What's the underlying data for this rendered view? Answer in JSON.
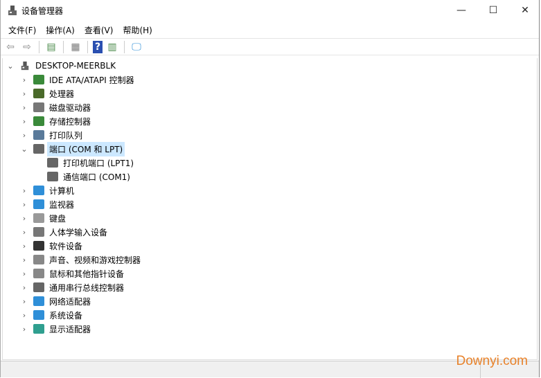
{
  "window": {
    "title": "设备管理器",
    "minimize": "—",
    "maximize": "☐",
    "close": "✕"
  },
  "menu": [
    "文件(F)",
    "操作(A)",
    "查看(V)",
    "帮助(H)"
  ],
  "toolbar": {
    "back": "⇦",
    "forward": "⇨",
    "properties": "▤",
    "update": "▦",
    "help": "?",
    "view": "▥",
    "scan": "🖵"
  },
  "tree": {
    "root": "DESKTOP-MEERBLK",
    "items": [
      {
        "label": "IDE ATA/ATAPI 控制器",
        "icon": "ide-icon",
        "color": "#3a8a3a"
      },
      {
        "label": "处理器",
        "icon": "cpu-icon",
        "color": "#4a6a2a"
      },
      {
        "label": "磁盘驱动器",
        "icon": "disk-icon",
        "color": "#777777"
      },
      {
        "label": "存储控制器",
        "icon": "storage-icon",
        "color": "#3a8a3a"
      },
      {
        "label": "打印队列",
        "icon": "printer-icon",
        "color": "#5a7a9a"
      },
      {
        "label": "端口 (COM 和 LPT)",
        "icon": "port-icon",
        "color": "#666666",
        "expanded": true,
        "children": [
          {
            "label": "打印机端口 (LPT1)",
            "icon": "port-icon"
          },
          {
            "label": "通信端口 (COM1)",
            "icon": "port-icon"
          }
        ]
      },
      {
        "label": "计算机",
        "icon": "computer-icon",
        "color": "#2f8fd8"
      },
      {
        "label": "监视器",
        "icon": "monitor-icon",
        "color": "#2f8fd8"
      },
      {
        "label": "键盘",
        "icon": "keyboard-icon",
        "color": "#999999"
      },
      {
        "label": "人体学输入设备",
        "icon": "hid-icon",
        "color": "#777777"
      },
      {
        "label": "软件设备",
        "icon": "software-device-icon",
        "color": "#333333"
      },
      {
        "label": "声音、视频和游戏控制器",
        "icon": "speaker-icon",
        "color": "#888888"
      },
      {
        "label": "鼠标和其他指针设备",
        "icon": "mouse-icon",
        "color": "#888888"
      },
      {
        "label": "通用串行总线控制器",
        "icon": "usb-icon",
        "color": "#666666"
      },
      {
        "label": "网络适配器",
        "icon": "network-icon",
        "color": "#2f8fd8"
      },
      {
        "label": "系统设备",
        "icon": "system-icon",
        "color": "#2f8fd8"
      },
      {
        "label": "显示适配器",
        "icon": "display-icon",
        "color": "#2f9f8f"
      }
    ]
  },
  "watermark": "Downyi.com"
}
